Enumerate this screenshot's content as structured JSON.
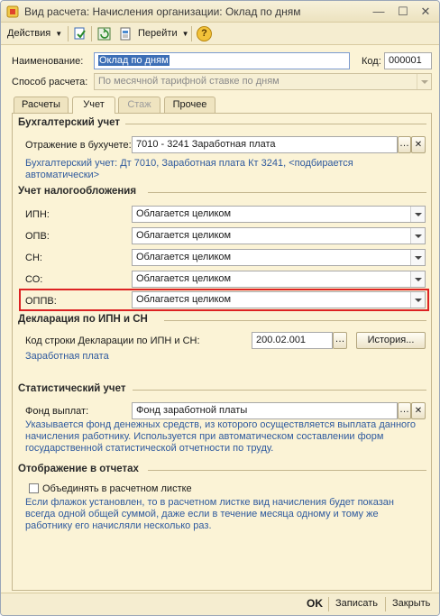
{
  "window": {
    "title": "Вид расчета: Начисления организации: Оклад по дням",
    "minimize_glyph": "—",
    "maximize_glyph": "☐",
    "close_glyph": "✕"
  },
  "toolbar": {
    "actions_label": "Действия",
    "goto_label": "Перейти",
    "help_glyph": "?"
  },
  "header": {
    "name_label": "Наименование:",
    "name_value": "Оклад по дням",
    "code_label": "Код:",
    "code_value": "000001",
    "method_label": "Способ расчета:",
    "method_value": "По месячной тарифной ставке по дням"
  },
  "tabs": [
    {
      "label": "Расчеты"
    },
    {
      "label": "Учет"
    },
    {
      "label": "Стаж"
    },
    {
      "label": "Прочее"
    }
  ],
  "accounting": {
    "section_title": "Бухгалтерский учет",
    "reflection_label": "Отражение в бухучете:",
    "reflection_value": "7010 - 3241 Заработная плата",
    "hint": "Бухгалтерский учет: Дт 7010, Заработная плата Кт 3241, <подбирается автоматически>"
  },
  "tax": {
    "section_title": "Учет налогообложения",
    "rows": [
      {
        "label": "ИПН:",
        "value": "Облагается целиком"
      },
      {
        "label": "ОПВ:",
        "value": "Облагается целиком"
      },
      {
        "label": "СН:",
        "value": "Облагается целиком"
      },
      {
        "label": "СО:",
        "value": "Облагается целиком"
      },
      {
        "label": "ОППВ:",
        "value": "Облагается целиком"
      }
    ]
  },
  "declaration": {
    "section_title": "Декларация по ИПН и СН",
    "code_label": "Код строки Декларации по ИПН и СН:",
    "code_value": "200.02.001",
    "history_button": "История...",
    "link_text": "Заработная плата"
  },
  "statistics": {
    "section_title": "Статистический учет",
    "fund_label": "Фонд выплат:",
    "fund_value": "Фонд заработной платы",
    "hint": "Указывается фонд денежных средств, из которого осуществляется выплата данного начисления работнику. Используется при автоматическом составлении форм государственной статистической отчетности по труду."
  },
  "reports": {
    "section_title": "Отображение в отчетах",
    "combine_label": "Объединять в расчетном листке",
    "combine_checked": false,
    "hint": "Если флажок установлен, то в расчетном листке вид начисления будет показан всегда одной общей суммой, даже если в течение месяца одному и тому же работнику его начисляли несколько раз."
  },
  "footer": {
    "ok_label": "OK",
    "save_label": "Записать",
    "close_label": "Закрыть"
  },
  "colors": {
    "window_bg": "#fbf3d6",
    "hint_text": "#2f5a9e",
    "highlight_border": "#dd2222",
    "selection_bg": "#3d6fb6"
  }
}
